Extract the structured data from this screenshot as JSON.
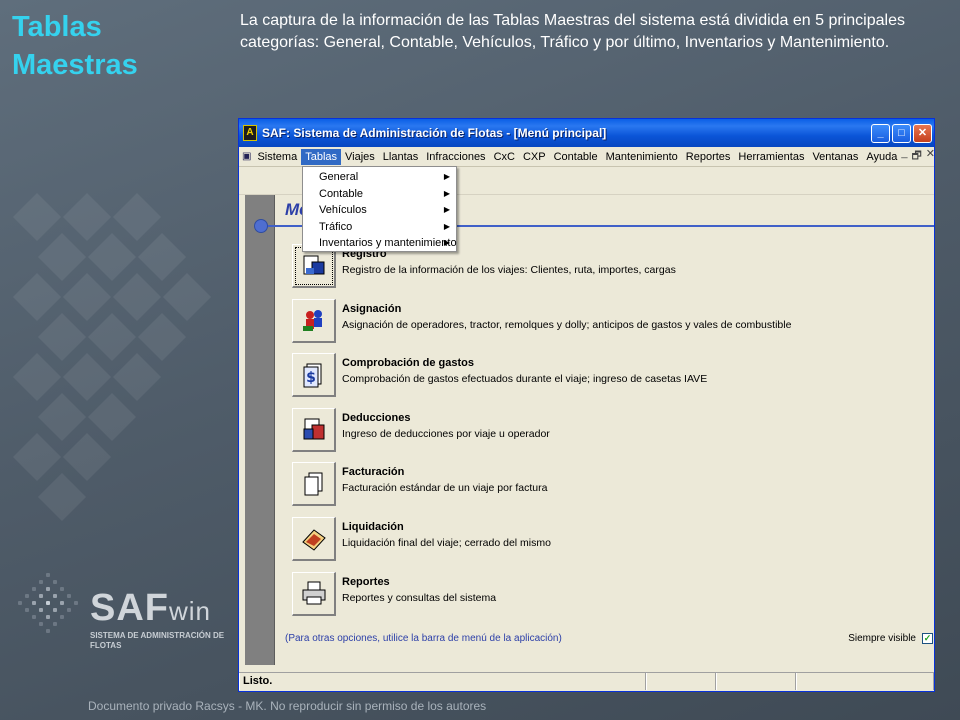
{
  "slide": {
    "title": "Tablas Maestras",
    "description": "La captura de la información de las Tablas Maestras del sistema está dividida en 5 principales categorías: General, Contable, Vehículos, Tráfico y por último, Inventarios y Mantenimiento.",
    "logo_main": "SAF",
    "logo_suffix": "win",
    "logo_tagline": "SISTEMA DE ADMINISTRACIÓN DE FLOTAS",
    "footer": "Documento privado Racsys - MK. No reproducir sin permiso de los autores"
  },
  "window": {
    "title": "SAF: Sistema de Administración de Flotas - [Menú principal]",
    "icon_letter": "A"
  },
  "menubar": {
    "items": [
      "Sistema",
      "Tablas",
      "Viajes",
      "Llantas",
      "Infracciones",
      "CxC",
      "CXP",
      "Contable",
      "Mantenimiento",
      "Reportes",
      "Herramientas",
      "Ventanas",
      "Ayuda"
    ],
    "active": "Tablas"
  },
  "dropdown": {
    "items": [
      "General",
      "Contable",
      "Vehículos",
      "Tráfico",
      "Inventarios y mantenimiento"
    ]
  },
  "content": {
    "section_title": "Me",
    "items": [
      {
        "name": "Registro",
        "desc": "Registro de la información de los viajes: Clientes, ruta, importes, cargas",
        "icon": "registro-icon"
      },
      {
        "name": "Asignación",
        "desc": "Asignación de operadores, tractor, remolques y dolly; anticipos de gastos y vales de combustible",
        "icon": "asignacion-icon"
      },
      {
        "name": "Comprobación de gastos",
        "desc": "Comprobación de gastos efectuados durante el viaje; ingreso de casetas IAVE",
        "icon": "comprobacion-icon"
      },
      {
        "name": "Deducciones",
        "desc": "Ingreso de deducciones por viaje u operador",
        "icon": "deducciones-icon"
      },
      {
        "name": "Facturación",
        "desc": "Facturación estándar de un viaje por factura",
        "icon": "facturacion-icon"
      },
      {
        "name": "Liquidación",
        "desc": "Liquidación final del viaje; cerrado del mismo",
        "icon": "liquidacion-icon"
      },
      {
        "name": "Reportes",
        "desc": "Reportes y consultas del sistema",
        "icon": "reportes-icon"
      }
    ],
    "hint": "(Para otras opciones, utilice la barra de menú de la aplicación)",
    "always_visible_label": "Siempre visible",
    "always_visible_checked": "✓"
  },
  "status": {
    "text": "Listo."
  }
}
